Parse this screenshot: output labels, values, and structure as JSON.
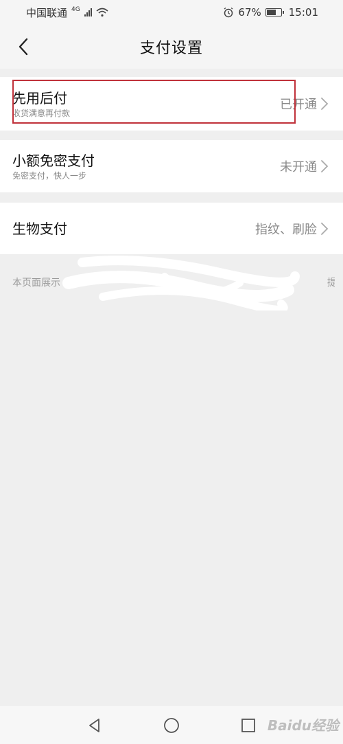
{
  "status_bar": {
    "carrier": "中国联通",
    "network": "4G",
    "battery": "67%",
    "battery_level": 0.67,
    "time": "15:01"
  },
  "nav": {
    "title": "支付设置"
  },
  "rows": [
    {
      "title": "先用后付",
      "subtitle": "收货满意再付款",
      "value": "已开通"
    },
    {
      "title": "小额免密支付",
      "subtitle": "免密支付，快人一步",
      "value": "未开通"
    },
    {
      "title": "生物支付",
      "subtitle": "",
      "value": "指纹、刷脸"
    }
  ],
  "footer": {
    "note_start": "本页面展示",
    "note_end": "提供"
  },
  "watermark": "Baidu经验",
  "colors": {
    "background": "#efefef",
    "card": "#ffffff",
    "highlight": "#c0313a",
    "value_text": "#8a8a8a"
  }
}
